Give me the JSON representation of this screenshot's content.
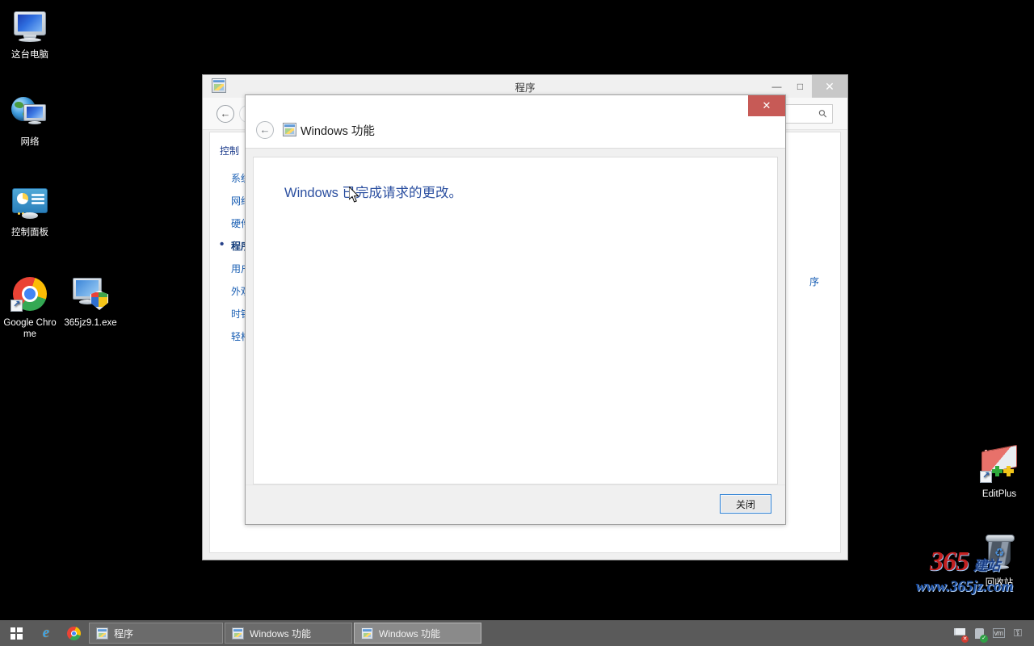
{
  "desktop": {
    "icons": [
      {
        "label": "这台电脑",
        "icon": "this-pc-icon"
      },
      {
        "label": "网络",
        "icon": "network-icon"
      },
      {
        "label": "控制面板",
        "icon": "control-panel-icon"
      },
      {
        "label": "Google Chrome",
        "icon": "google-chrome-icon"
      },
      {
        "label": "365jz9.1.exe",
        "icon": "executable-shield-icon"
      },
      {
        "label": "EditPlus",
        "icon": "editplus-icon"
      },
      {
        "label": "回收站",
        "icon": "recycle-bin-icon"
      }
    ],
    "watermark": {
      "number": "365",
      "suffix": "建站",
      "url": "www.365jz.com"
    }
  },
  "main_window": {
    "title": "程序",
    "icon": "control-panel-app-icon",
    "buttons": {
      "minimize": "—",
      "maximize": "□",
      "close": "✕"
    },
    "nav": {
      "back": "←",
      "forward": "→",
      "search_placeholder": "",
      "search_icon": "search-icon"
    },
    "sidebar": {
      "home": "控制",
      "items": [
        {
          "label": "系统",
          "selected": false
        },
        {
          "label": "网络",
          "selected": false
        },
        {
          "label": "硬件",
          "selected": false
        },
        {
          "label": "程序",
          "selected": true
        },
        {
          "label": "用户",
          "selected": false
        },
        {
          "label": "外观",
          "selected": false
        },
        {
          "label": "时钟",
          "selected": false
        },
        {
          "label": "轻松",
          "selected": false
        }
      ]
    },
    "content": {
      "fragment": "序"
    }
  },
  "dialog": {
    "title": "Windows 功能",
    "icon": "windows-features-icon",
    "back_arrow": "←",
    "close_x": "✕",
    "message": "Windows 已完成请求的更改。",
    "close_button": "关闭"
  },
  "taskbar": {
    "start": "start-button",
    "quick_launch": [
      {
        "name": "internet-explorer-icon",
        "glyph": "e"
      },
      {
        "name": "google-chrome-icon",
        "glyph": ""
      }
    ],
    "items": [
      {
        "label": "程序",
        "active": false
      },
      {
        "label": "Windows 功能",
        "active": false
      },
      {
        "label": "Windows 功能",
        "active": true
      }
    ],
    "tray": [
      {
        "name": "action-center-flag-icon",
        "badge": "✕"
      },
      {
        "name": "network-status-icon",
        "badge": "✓"
      },
      {
        "name": "vm-tools-icon",
        "label": "vm"
      },
      {
        "name": "key-icon",
        "label": "⚿"
      }
    ]
  },
  "colors": {
    "desktop_bg": "#000000",
    "taskbar_bg": "#5a5a5a",
    "dialog_close_red": "#c75a56",
    "message_blue": "#2b4fa0",
    "link_blue": "#1a5fb4",
    "focus_border": "#2a7fd4"
  }
}
